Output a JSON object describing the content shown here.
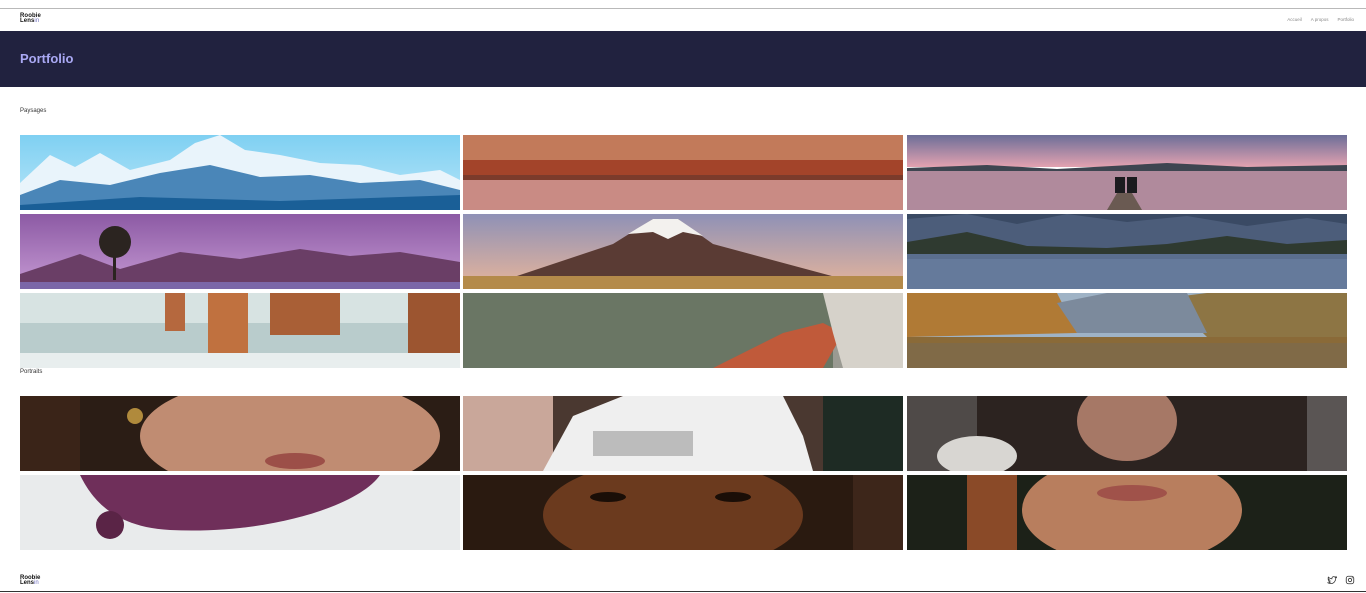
{
  "brand": {
    "line1": "Roobie",
    "line2": "Lens",
    "accent": "in"
  },
  "nav": {
    "items": [
      "Accueil",
      "A propos",
      "Portfolio"
    ]
  },
  "banner": {
    "title": "Portfolio",
    "bg": "#21223f",
    "color": "#aaa9f4"
  },
  "sections": {
    "landscapes": {
      "title": "Paysages",
      "photos": [
        "Snowy mountain range",
        "Salt lake at dusk",
        "Couple on a jetty by a lake",
        "Lone tree by a purple lake",
        "Snow-capped volcano",
        "Fjord reflections",
        "Sea stacks on the coast",
        "Red geothermal pool",
        "Alpine lake reflection"
      ]
    },
    "portraits": {
      "title": "Portraits",
      "photos": [
        "Woman with gold earring",
        "Person in white t-shirt",
        "Man with hat",
        "Woman with purple hair",
        "Woman with dark eyes",
        "Woman with auburn hair"
      ]
    }
  },
  "footer": {
    "line1": "Roobie",
    "line2": "Lens",
    "accent": "in",
    "social": [
      "twitter-icon",
      "instagram-icon"
    ]
  }
}
